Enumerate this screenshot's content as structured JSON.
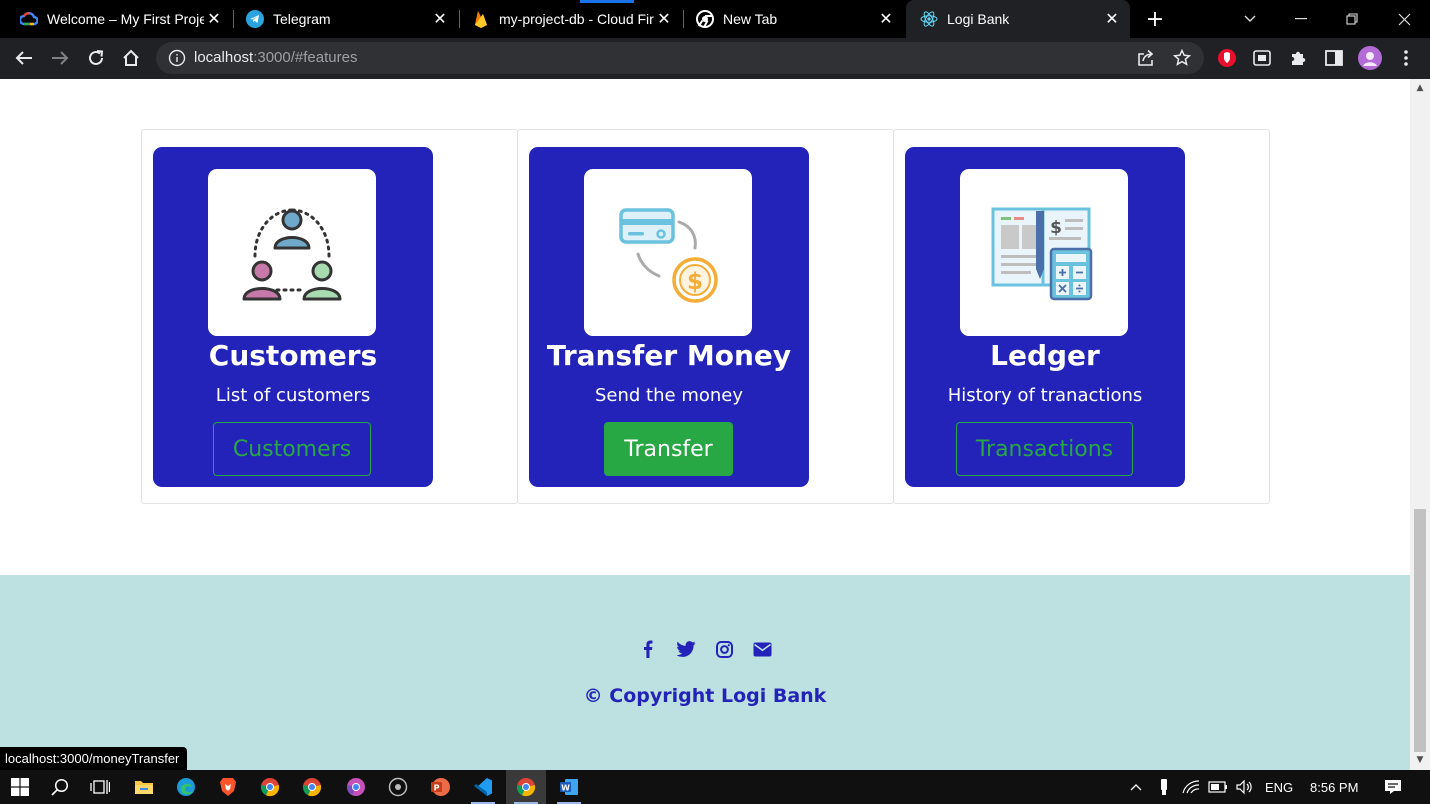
{
  "browser": {
    "tabs": [
      {
        "title": "Welcome – My First Proje",
        "icon": "google-cloud-icon",
        "close": "✕"
      },
      {
        "title": "Telegram",
        "icon": "telegram-icon",
        "close": "✕"
      },
      {
        "title": "my-project-db - Cloud Fir",
        "icon": "firebase-icon",
        "close": "✕"
      },
      {
        "title": "New Tab",
        "icon": "chrome-icon",
        "close": "✕"
      },
      {
        "title": "Logi Bank",
        "icon": "react-icon",
        "close": "✕",
        "active": true
      }
    ],
    "new_tab": "+",
    "address": {
      "host": "localhost",
      "rest": ":3000/#features"
    }
  },
  "features": [
    {
      "title": "Customers",
      "subtitle": "List of customers",
      "button": "Customers",
      "icon": "customers-network-icon",
      "style": "outline"
    },
    {
      "title": "Transfer Money",
      "subtitle": "Send the money",
      "button": "Transfer",
      "icon": "card-to-coin-icon",
      "style": "filled"
    },
    {
      "title": "Ledger",
      "subtitle": "History of tranactions",
      "button": "Transactions",
      "icon": "ledger-calculator-icon",
      "style": "outline"
    }
  ],
  "footer": {
    "social": [
      "facebook-icon",
      "twitter-icon",
      "instagram-icon",
      "envelope-icon"
    ],
    "copyright": "© Copyright Logi Bank"
  },
  "status_bar": {
    "url": "localhost:3000/moneyTransfer"
  },
  "taskbar": {
    "language": "ENG",
    "time": "8:56 PM"
  },
  "colors": {
    "card": "#2323b9",
    "accent_green": "#28a745",
    "footer_bg": "#bde0e0",
    "footer_text": "#2323b9"
  }
}
